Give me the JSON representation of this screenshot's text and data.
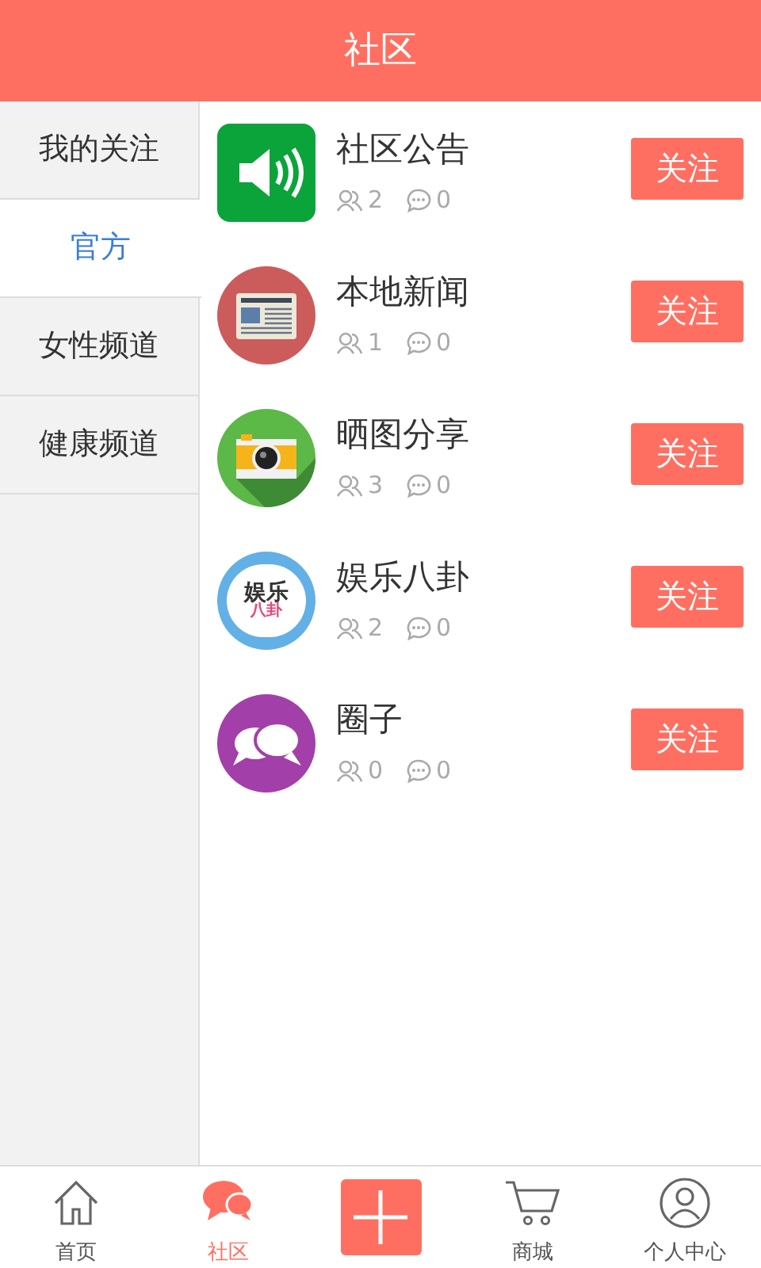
{
  "header": {
    "title": "社区"
  },
  "sidebar": {
    "items": [
      {
        "label": "我的关注",
        "selected": false
      },
      {
        "label": "官方",
        "selected": true
      },
      {
        "label": "女性频道",
        "selected": false
      },
      {
        "label": "健康频道",
        "selected": false
      }
    ]
  },
  "channels": [
    {
      "kind": "speaker",
      "name": "社区公告",
      "members": "2",
      "comments": "0",
      "button": "关注"
    },
    {
      "kind": "newspaper",
      "name": "本地新闻",
      "members": "1",
      "comments": "0",
      "button": "关注"
    },
    {
      "kind": "camera",
      "name": "晒图分享",
      "members": "3",
      "comments": "0",
      "button": "关注"
    },
    {
      "kind": "gossip",
      "name": "娱乐八卦",
      "members": "2",
      "comments": "0",
      "button": "关注",
      "logo_text": [
        "娱乐",
        "八卦"
      ]
    },
    {
      "kind": "bubbles",
      "name": "圈子",
      "members": "0",
      "comments": "0",
      "button": "关注"
    }
  ],
  "bottom_nav": [
    {
      "kind": "home",
      "label": "首页",
      "selected": false
    },
    {
      "kind": "chat",
      "label": "社区",
      "selected": true
    },
    {
      "kind": "plus",
      "selected": false
    },
    {
      "kind": "cart",
      "label": "商城",
      "selected": false
    },
    {
      "kind": "person",
      "label": "个人中心",
      "selected": false
    }
  ]
}
